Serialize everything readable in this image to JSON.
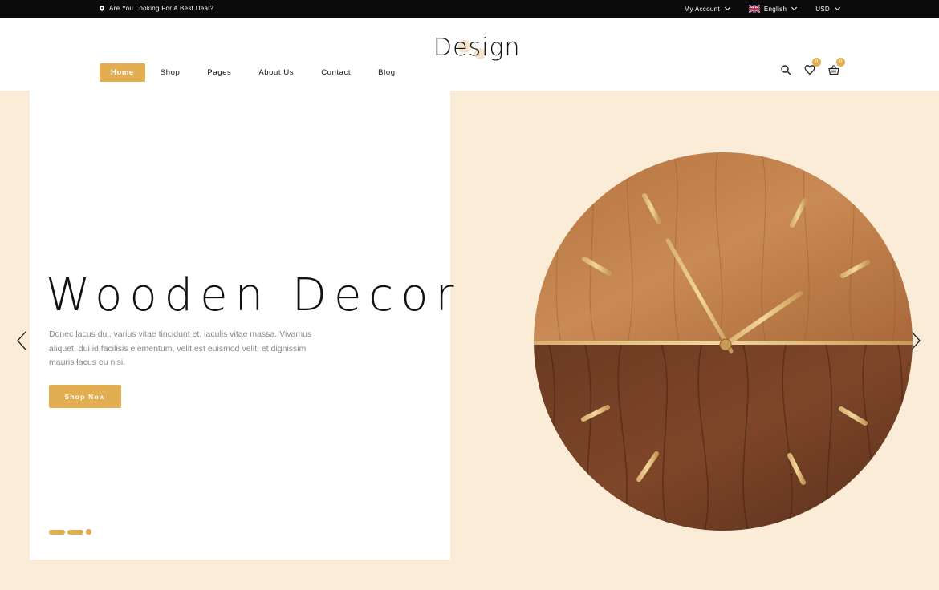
{
  "topbar": {
    "deal_text": "Are You Looking For A Best Deal?",
    "account_label": "My Account",
    "language_label": "English",
    "currency_label": "USD"
  },
  "header": {
    "logo_text": "Design",
    "nav": [
      {
        "label": "Home",
        "active": true
      },
      {
        "label": "Shop"
      },
      {
        "label": "Pages"
      },
      {
        "label": "About Us"
      },
      {
        "label": "Contact"
      },
      {
        "label": "Blog"
      }
    ],
    "wishlist_count": "0",
    "cart_count": "0",
    "icons": [
      "search-icon",
      "heart-icon",
      "basket-icon"
    ]
  },
  "hero": {
    "title": "Wooden Decor",
    "description": "Donec lacus dui, varius vitae tincidunt et, iaculis vitae massa. Vivamus aliquet, dui id facilisis elementum, velit est euismod velit, et dignissim mauris lacus eu nisi.",
    "button_label": "Shop Now",
    "slides": 3,
    "active_slide": 3
  },
  "colors": {
    "accent": "#e3ad52",
    "background": "#fbecd8",
    "topbar": "#0b0b0b"
  }
}
